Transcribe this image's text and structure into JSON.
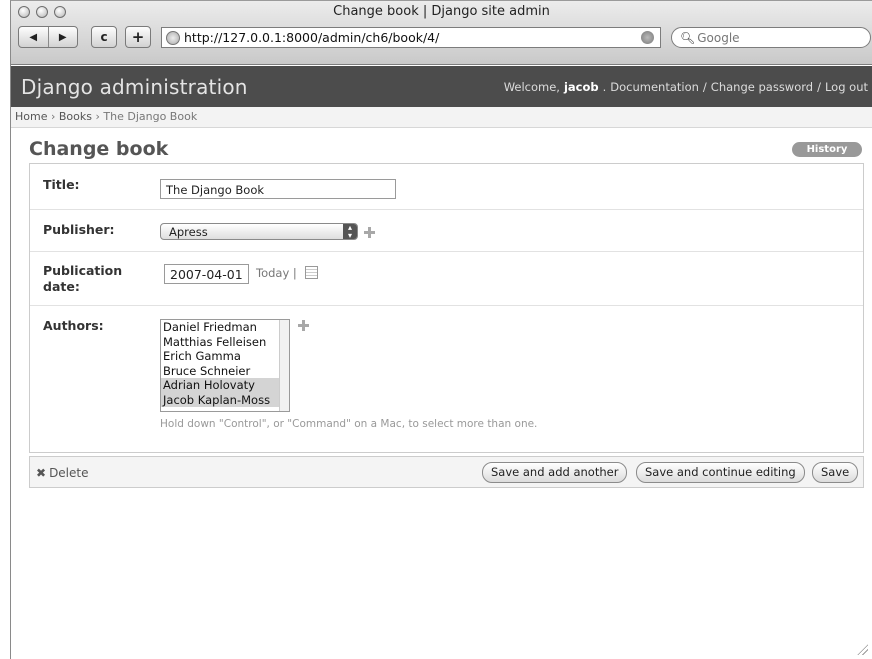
{
  "window": {
    "title": "Change book | Django site admin"
  },
  "toolbar": {
    "back_icon": "◀",
    "forward_icon": "▶",
    "reload_icon": "c",
    "add_bookmark_icon": "+",
    "url": "http://127.0.0.1:8000/admin/ch6/book/4/",
    "search_placeholder": "Google"
  },
  "header": {
    "brand": "Django administration",
    "welcome": "Welcome,",
    "username": "jacob",
    "links": [
      "Documentation",
      "/",
      "Change password",
      "/",
      "Log out"
    ]
  },
  "breadcrumbs": {
    "home": "Home",
    "sep": "›",
    "section": "Books",
    "current": "The Django Book"
  },
  "page": {
    "title": "Change book",
    "history_label": "History"
  },
  "form": {
    "title_label": "Title:",
    "title_value": "The Django Book",
    "publisher_label": "Publisher:",
    "publisher_selected": "Apress",
    "pubdate_label_1": "Publication",
    "pubdate_label_2": "date:",
    "pubdate_value": "2007-04-01",
    "today_link": "Today",
    "today_sep": "|",
    "authors_label": "Authors:",
    "authors": [
      {
        "name": "Daniel Friedman",
        "selected": false
      },
      {
        "name": "Matthias Felleisen",
        "selected": false
      },
      {
        "name": "Erich Gamma",
        "selected": false
      },
      {
        "name": "Bruce Schneier",
        "selected": false
      },
      {
        "name": "Adrian Holovaty",
        "selected": true
      },
      {
        "name": "Jacob Kaplan-Moss",
        "selected": true
      }
    ],
    "authors_help": "Hold down \"Control\", or \"Command\" on a Mac, to select more than one."
  },
  "actions": {
    "delete_icon": "✖",
    "delete_label": "Delete",
    "save_add": "Save and add another",
    "save_continue": "Save and continue editing",
    "save": "Save"
  }
}
